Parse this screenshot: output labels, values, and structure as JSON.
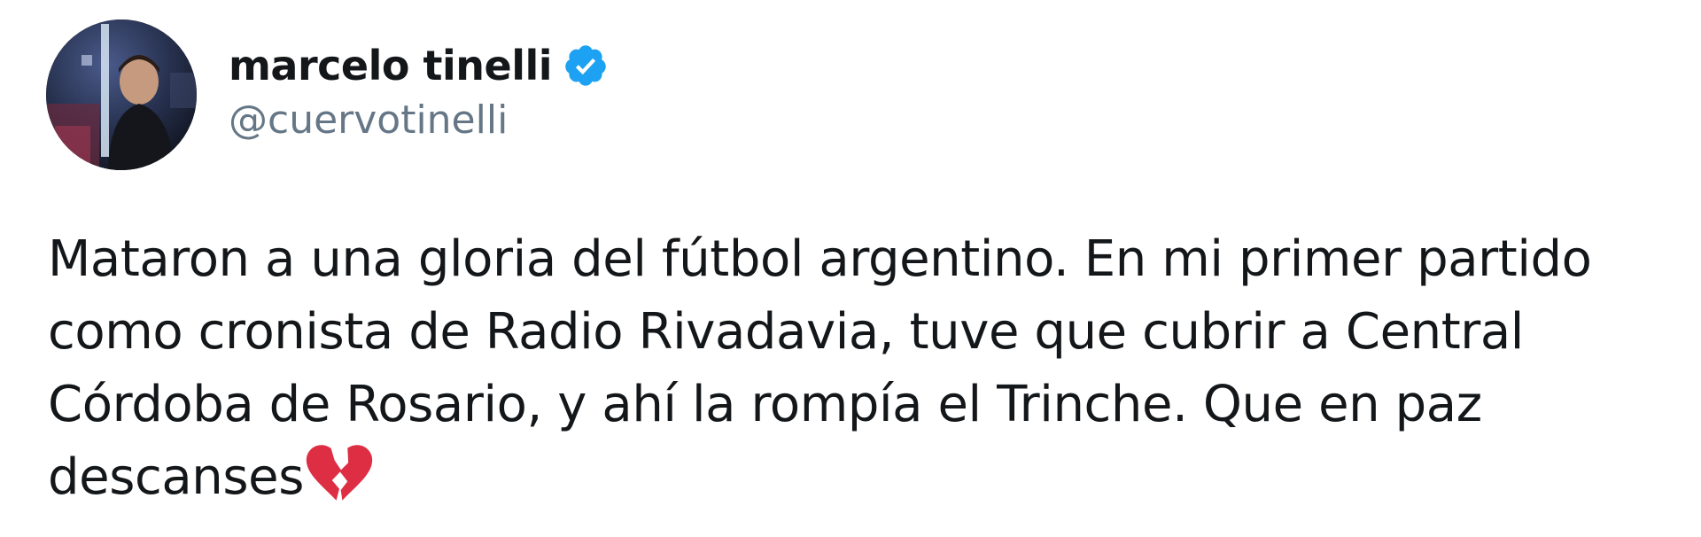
{
  "tweet": {
    "author": {
      "display_name": "marcelo tinelli",
      "username": "@cuervotinelli",
      "verified": true,
      "avatar_icon": "profile-photo"
    },
    "text_lines": [
      "Mataron a una gloria del fútbol argentino. En mi primer partido",
      "como cronista de Radio Rivadavia, tuve que cubrir a Central",
      "Córdoba de Rosario, y ahí la rompía el Trinche. Que en paz",
      "descanses"
    ],
    "emoji": "broken-heart-icon"
  },
  "colors": {
    "text_primary": "#14171a",
    "text_secondary": "#657786",
    "verified_badge": "#1da1f2",
    "emoji_red": "#dd2e44"
  }
}
